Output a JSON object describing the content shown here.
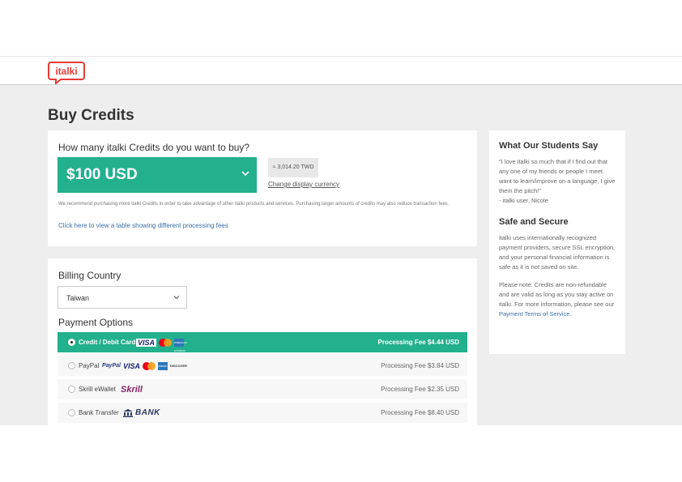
{
  "brand": {
    "logo_text": "italki",
    "color": "#e63b33",
    "accent": "#22b08d"
  },
  "page": {
    "title": "Buy Credits"
  },
  "credits": {
    "question": "How many italki Credits do you want to buy?",
    "amount": "$100 USD",
    "converted": "≈ 3,014.20 TWD",
    "change_currency": "Change display currency",
    "recommendation": "We recommend purchasing more italki Credits in order to take advantage of other italki products and services. Purchasing larger amounts of credits may also reduce transaction fees.",
    "fees_link": "Click here to view a table showing different processing fees"
  },
  "billing": {
    "label": "Billing Country",
    "country": "Taiwan"
  },
  "payment": {
    "label": "Payment Options",
    "options": [
      {
        "name": "Credit / Debit Card",
        "fee": "Processing Fee $4.44 USD",
        "selected": true,
        "logos": [
          "VISA",
          "mastercard-icon",
          "AMERICAN EXPRESS"
        ]
      },
      {
        "name": "PayPal",
        "fee": "Processing Fee $3.84 USD",
        "selected": false,
        "logos": [
          "PayPal",
          "VISA",
          "mastercard-icon",
          "AMERICAN EXPRESS",
          "DISCOVER"
        ]
      },
      {
        "name": "Skrill eWallet",
        "fee": "Processing Fee $2.35 USD",
        "selected": false,
        "logos": [
          "Skrill"
        ]
      },
      {
        "name": "Bank Transfer",
        "fee": "Processing Fee $8.40 USD",
        "selected": false,
        "logos": [
          "BANK"
        ]
      }
    ]
  },
  "sidebar": {
    "testimonial_title": "What Our Students Say",
    "testimonial": "\"I love italki so much that if I find out that any one of my friends or people I meet want to learn/improve on a language, I give them the pitch!\"",
    "testimonial_author": "- italki user, Nicole",
    "secure_title": "Safe and Secure",
    "secure_text": "italki uses internationally recognized payment providers, secure SSL encryption, and your personal financial information is safe as it is not saved on site.",
    "note_text": "Please note: Credits are non-refundable and are valid as long as you stay active on italki. For more information, please see our",
    "note_link": "Payment Terms of Service",
    "note_end": "."
  }
}
